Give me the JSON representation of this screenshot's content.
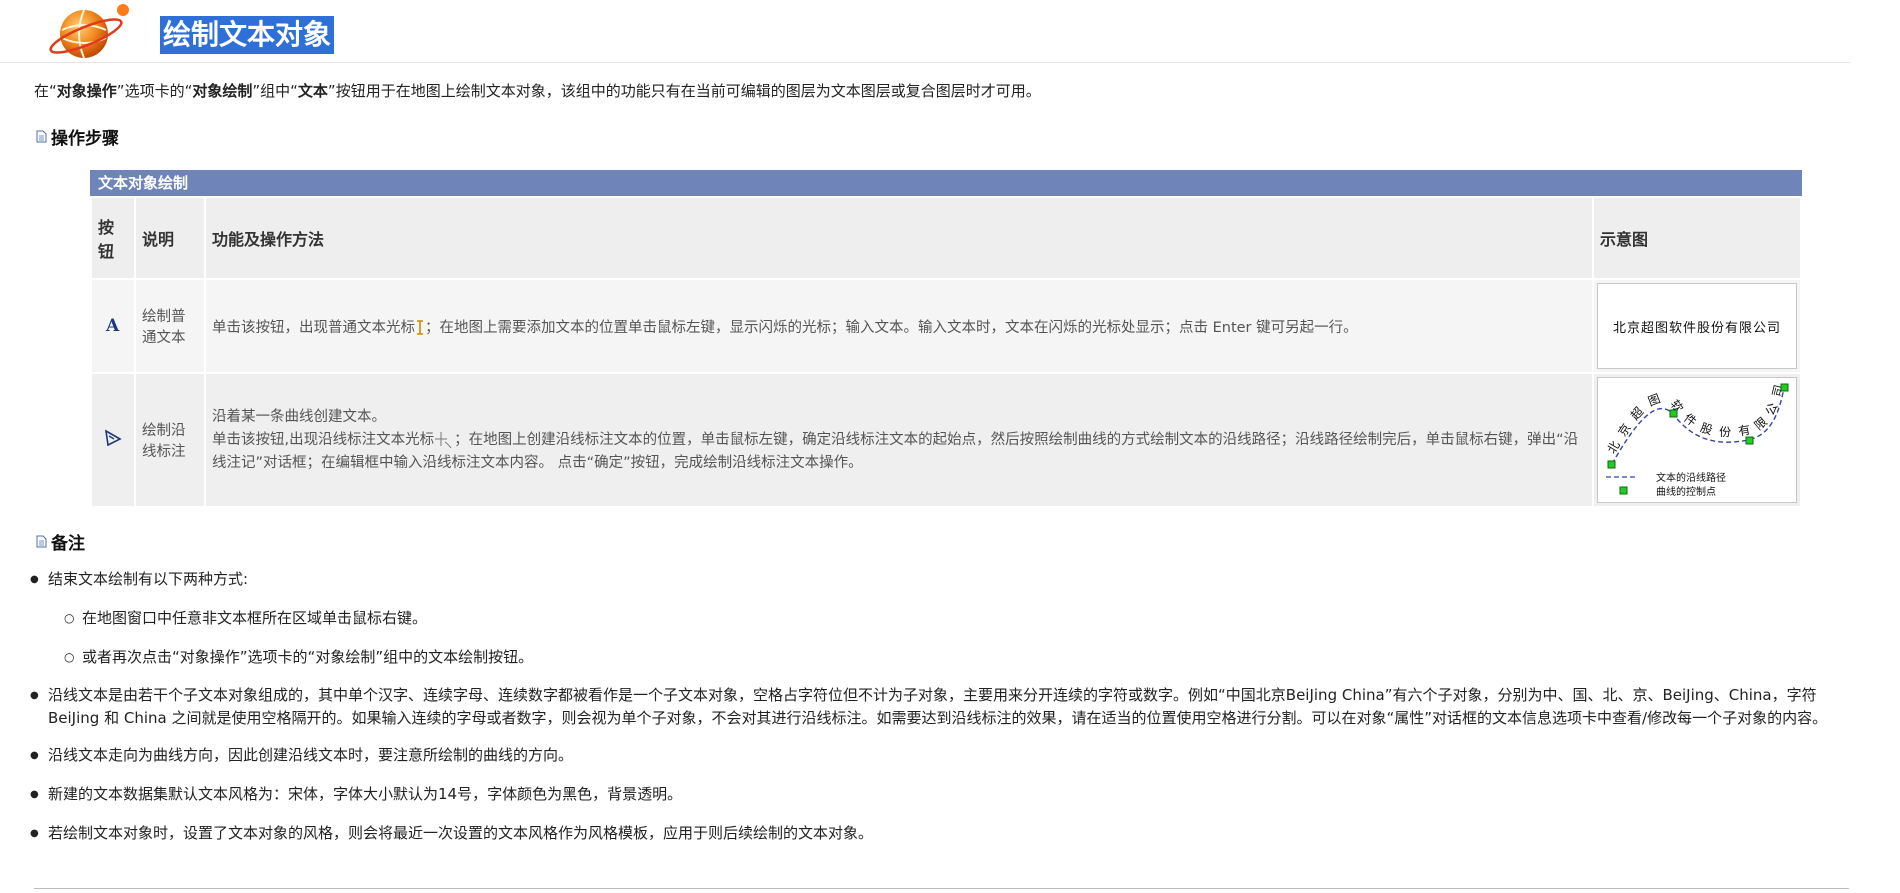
{
  "header": {
    "title": "绘制文本对象"
  },
  "intro": {
    "p1": "在“",
    "b1": "对象操作",
    "p2": "”选项卡的“",
    "b2": "对象绘制",
    "p3": "”组中“",
    "b3": "文本",
    "p4": "”按钮用于在地图上绘制文本对象，该组中的功能只有在当前可编辑的图层为文本图层或复合图层时才可用。"
  },
  "sections": {
    "steps": "操作步骤",
    "notes": "备注"
  },
  "table": {
    "caption": "文本对象绘制",
    "headers": [
      "按钮",
      "说明",
      "功能及操作方法",
      "示意图"
    ],
    "rows": [
      {
        "button_icon": "text-a-icon",
        "desc": "绘制普通文本",
        "method_a": "单击该按钮，出现普通文本光标",
        "method_b": "；在地图上需要添加文本的位置单击鼠标左键，显示闪烁的光标；输入文本。输入文本时，文本在闪烁的光标处显示；点击 Enter 键可另起一行。",
        "sample": "北京超图软件股份有限公司"
      },
      {
        "button_icon": "curve-text-icon",
        "desc": "绘制沿线标注",
        "method_line1": "沿着某一条曲线创建文本。",
        "method_a": "单击该按钮,出现沿线标注文本光标",
        "method_b": "；在地图上创建沿线标注文本的位置，单击鼠标左键，确定沿线标注文本的起始点，然后按照绘制曲线的方式绘制文本的沿线路径；沿线路径绘制完后，单击鼠标右键，弹出“沿线注记”对话框；在编辑框中输入沿线标注文本内容。 点击“确定”按钮，完成绘制沿线标注文本操作。",
        "curve_chars": [
          "北",
          "京",
          "超",
          "图",
          "软",
          "件",
          "股",
          "份",
          "有",
          "限",
          "公",
          "司"
        ],
        "legend_path": "文本的沿线路径",
        "legend_points": "曲线的控制点"
      }
    ]
  },
  "notes": {
    "n1": "结束文本绘制有以下两种方式:",
    "n1_sub1": "在地图窗口中任意非文本框所在区域单击鼠标右键。",
    "n1_sub2": "或者再次点击“对象操作”选项卡的“对象绘制”组中的文本绘制按钮。",
    "n2": "沿线文本是由若干个子文本对象组成的，其中单个汉字、连续字母、连续数字都被看作是一个子文本对象，空格占字符位但不计为子对象，主要用来分开连续的字符或数字。例如“中国北京BeiJing China”有六个子对象，分别为中、国、北、京、BeiJing、China，字符 BeiJing 和 China 之间就是使用空格隔开的。如果输入连续的字母或者数字，则会视为单个子对象，不会对其进行沿线标注。如需要达到沿线标注的效果，请在适当的位置使用空格进行分割。可以在对象“属性”对话框的文本信息选项卡中查看/修改每一个子对象的内容。",
    "n3": "沿线文本走向为曲线方向，因此创建沿线文本时，要注意所绘制的曲线的方向。",
    "n4": "新建的文本数据集默认文本风格为：宋体，字体大小默认为14号，字体颜色为黑色，背景透明。",
    "n5": "若绘制文本对象时，设置了文本对象的风格，则会将最近一次设置的文本风格作为风格模板，应用于则后续绘制的文本对象。"
  },
  "colors": {
    "caption_bg": "#6f84b8",
    "title_highlight": "#2f6fd8",
    "accent_green": "#22aa22",
    "curve_blue": "#3344aa"
  }
}
